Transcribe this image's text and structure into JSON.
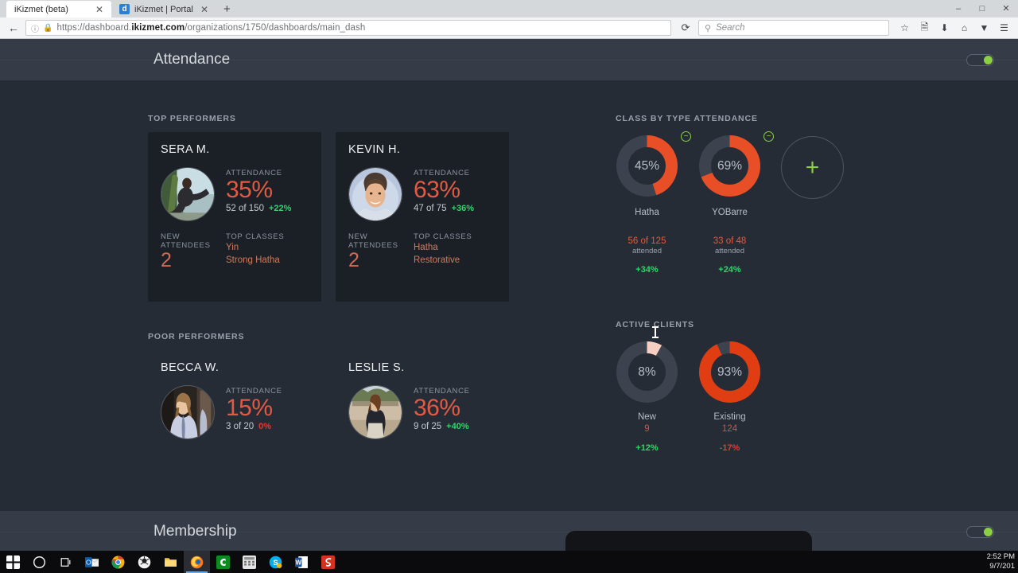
{
  "browser": {
    "tabs": [
      {
        "title": "iKizmet (beta)",
        "favicon": "",
        "active": true,
        "close": "✕"
      },
      {
        "title": "iKizmet | Portal",
        "favicon": "d",
        "active": false,
        "close": "✕"
      }
    ],
    "new_tab_label": "+",
    "window_controls": {
      "minimize": "—",
      "maximize": "❐",
      "close": "✕"
    },
    "back_icon": "←",
    "identity_icon": "ⓘ",
    "lock_icon": "ὑ2",
    "url_prefix": "https://dashboard.",
    "url_domain": "ikizmet.com",
    "url_path": "/organizations/1750/dashboards/main_dash",
    "reload_icon": "↻",
    "search_placeholder": "Search",
    "search_value": "",
    "search_icon": "⌕",
    "nav_icons": [
      "☆",
      "὜E",
      "⬇",
      "⌂",
      "▼",
      "☰"
    ]
  },
  "sections": {
    "attendance": {
      "title": "Attendance",
      "toggle_on": true
    },
    "membership": {
      "title": "Membership",
      "toggle_on": true
    }
  },
  "top_performers": {
    "label": "TOP PERFORMERS",
    "cards": [
      {
        "name": "SERA M.",
        "attendance_label": "ATTENDANCE",
        "attendance_pct": "35%",
        "ratio": "52 of 150",
        "delta": "+22%",
        "delta_dir": "up",
        "new_attendees_label": "NEW ATTENDEES",
        "new_attendees": "2",
        "top_classes_label": "TOP CLASSES",
        "top_classes": [
          "Yin",
          "Strong Hatha"
        ],
        "avatar": "woman-yoga-pose-photo"
      },
      {
        "name": "KEVIN H.",
        "attendance_label": "ATTENDANCE",
        "attendance_pct": "63%",
        "ratio": "47 of 75",
        "delta": "+36%",
        "delta_dir": "up",
        "new_attendees_label": "NEW ATTENDEES",
        "new_attendees": "2",
        "top_classes_label": "TOP CLASSES",
        "top_classes": [
          "Hatha",
          "Restorative"
        ],
        "avatar": "smiling-man-photo"
      }
    ]
  },
  "poor_performers": {
    "label": "POOR PERFORMERS",
    "cards": [
      {
        "name": "BECCA W.",
        "attendance_label": "ATTENDANCE",
        "attendance_pct": "15%",
        "ratio": "3 of 20",
        "delta": "0%",
        "delta_dir": "flat",
        "avatar": "woman-mirror-photo"
      },
      {
        "name": "LESLIE S.",
        "attendance_label": "ATTENDANCE",
        "attendance_pct": "36%",
        "ratio": "9 of 25",
        "delta": "+40%",
        "delta_dir": "up",
        "avatar": "woman-outdoors-photo"
      }
    ]
  },
  "class_by_type": {
    "label": "CLASS BY TYPE ATTENDANCE",
    "add_button": "+",
    "remove_button": "−",
    "items": [
      {
        "name": "Hatha",
        "pct": "45%",
        "value": 45,
        "ratio": "56 of 125",
        "ratio_sub": "attended",
        "delta": "+34%",
        "delta_dir": "up"
      },
      {
        "name": "YOBarre",
        "pct": "69%",
        "value": 69,
        "ratio": "33 of 48",
        "ratio_sub": "attended",
        "delta": "+24%",
        "delta_dir": "up"
      }
    ]
  },
  "active_clients": {
    "label": "ACTIVE CLIENTS",
    "items": [
      {
        "name": "New",
        "pct": "8%",
        "value": 8,
        "count": "9",
        "delta": "+12%",
        "delta_dir": "up",
        "color": "#f6cfc2"
      },
      {
        "name": "Existing",
        "pct": "93%",
        "value": 93,
        "count": "124",
        "delta": "-17%",
        "delta_dir": "down",
        "color": "#e03d12"
      }
    ]
  },
  "colors": {
    "accent_orange": "#e84f26",
    "accent_green": "#8ccf45",
    "up_green": "#2fd46a",
    "down_red": "#e03c2c",
    "track": "#3c434e",
    "page_bg": "#262c36",
    "card_bg": "#1b2027",
    "header_bg": "#353c47"
  },
  "taskbar": {
    "items": [
      "start-icon",
      "cortana-icon",
      "task-view-icon",
      "outlook-icon",
      "chrome-icon",
      "app-icon",
      "file-explorer-icon",
      "firefox-icon",
      "camtasia-icon",
      "calculator-icon",
      "skype-icon",
      "word-icon",
      "snagit-icon"
    ],
    "active_index": 7,
    "clock_time": "2:52 PM",
    "clock_date": "9/7/201"
  }
}
